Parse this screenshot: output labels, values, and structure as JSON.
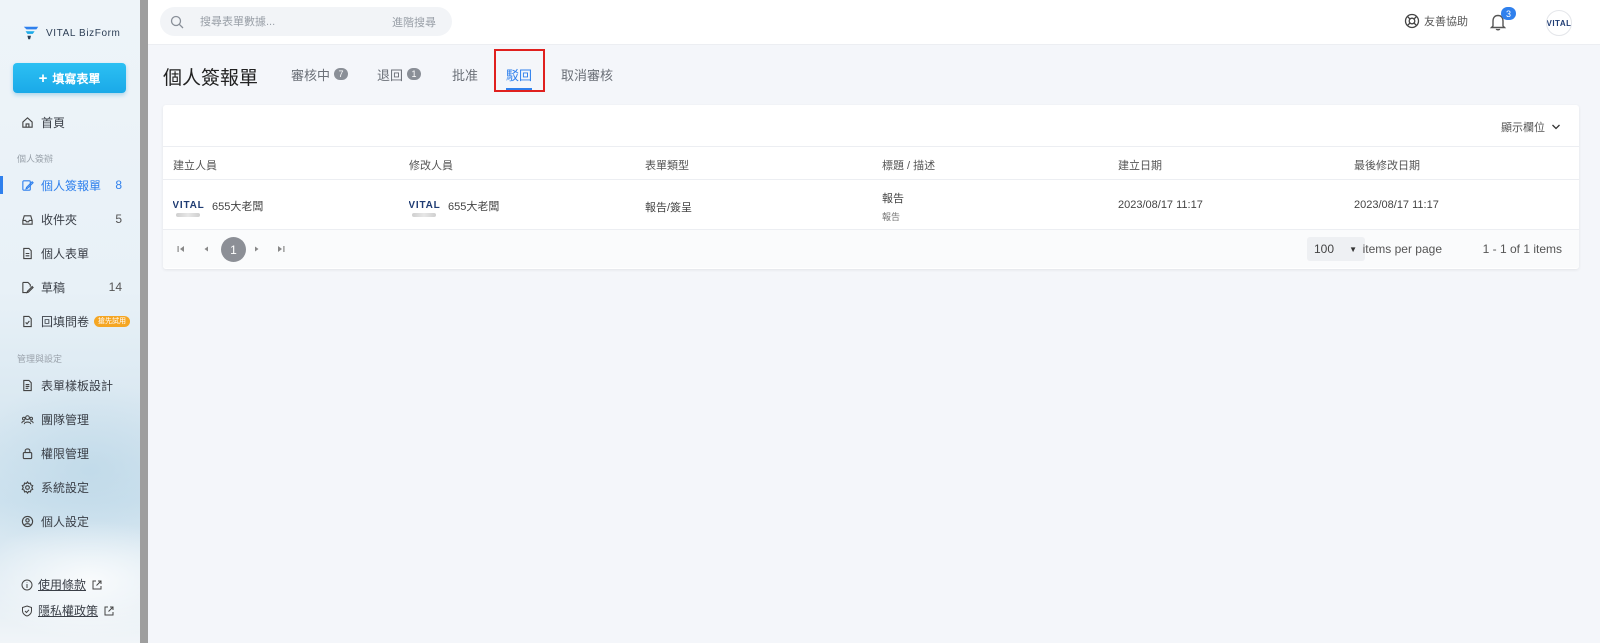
{
  "app": {
    "logo_text": "VITAL BizForm",
    "fill_button_label": "填寫表單"
  },
  "sidebar": {
    "section_personal": "個人簽辦",
    "section_admin": "管理與設定",
    "items": [
      {
        "label": "首頁",
        "icon": "home-icon"
      },
      {
        "label": "個人簽報單",
        "count": "8",
        "icon": "edit-form-icon",
        "active": true
      },
      {
        "label": "收件夾",
        "count": "5",
        "icon": "inbox-icon"
      },
      {
        "label": "個人表單",
        "icon": "document-icon"
      },
      {
        "label": "草稿",
        "count": "14",
        "icon": "draft-icon"
      },
      {
        "label": "回填問卷",
        "badge": "搶先試用",
        "icon": "survey-icon"
      },
      {
        "label": "表單樣板設計",
        "icon": "template-icon"
      },
      {
        "label": "團隊管理",
        "icon": "team-icon"
      },
      {
        "label": "權限管理",
        "icon": "lock-icon"
      },
      {
        "label": "系統設定",
        "icon": "gear-icon"
      },
      {
        "label": "個人設定",
        "icon": "user-circle-icon"
      }
    ],
    "footer": [
      {
        "label": "使用條款",
        "icon": "info-icon"
      },
      {
        "label": "隱私權政策",
        "icon": "shield-icon"
      }
    ]
  },
  "topbar": {
    "search_placeholder": "搜尋表單數據...",
    "advanced_search": "進階搜尋",
    "help_label": "友善協助",
    "notification_count": "3",
    "avatar_text": "VITAL"
  },
  "page": {
    "title": "個人簽報單",
    "tabs": [
      {
        "label": "審核中",
        "badge": "7"
      },
      {
        "label": "退回",
        "badge": "1"
      },
      {
        "label": "批准"
      },
      {
        "label": "駁回",
        "active": true
      },
      {
        "label": "取消審核"
      }
    ]
  },
  "table": {
    "column_toggle": "顯示欄位",
    "columns": [
      "建立人員",
      "修改人員",
      "表單類型",
      "標題 / 描述",
      "建立日期",
      "最後修改日期"
    ],
    "rows": [
      {
        "creator": "655大老闆",
        "modifier": "655大老闆",
        "form_type": "報告/簽呈",
        "title": "報告",
        "description": "報告",
        "created": "2023/08/17 11:17",
        "modified": "2023/08/17 11:17",
        "avatar_text": "VITAL"
      }
    ]
  },
  "pagination": {
    "current_page": "1",
    "page_size": "100",
    "items_per_page_label": "items per page",
    "info": "1 - 1 of 1 items"
  },
  "colors": {
    "accent": "#2f80ed",
    "button_gradient_top": "#2cc0f3",
    "highlight": "#e0201e",
    "badge_orange": "#f5a623"
  }
}
